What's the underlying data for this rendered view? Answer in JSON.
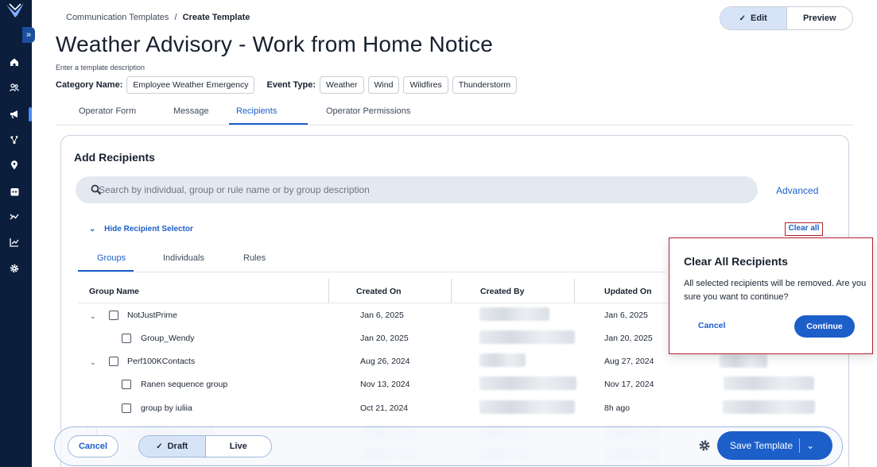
{
  "breadcrumb": {
    "parent": "Communication Templates",
    "separator": "/",
    "current": "Create Template"
  },
  "page_title": "Weather Advisory - Work from Home Notice",
  "description_placeholder": "Enter a template description",
  "category": {
    "label": "Category Name:",
    "value": "Employee Weather Emergency"
  },
  "event_type": {
    "label": "Event Type:",
    "values": [
      "Weather",
      "Wind",
      "Wildfires",
      "Thunderstorm"
    ]
  },
  "mode_toggle": {
    "edit": "Edit",
    "preview": "Preview",
    "selected": "Edit"
  },
  "tabs": [
    "Operator Form",
    "Message",
    "Recipients",
    "Operator Permissions"
  ],
  "active_tab": "Recipients",
  "recipients": {
    "title": "Add Recipients",
    "search_placeholder": "Search by individual, group or rule name or by group description",
    "advanced": "Advanced",
    "hide_selector": "Hide Recipient Selector",
    "clear_all": "Clear all",
    "subtabs": [
      "Groups",
      "Individuals",
      "Rules"
    ],
    "active_subtab": "Groups",
    "columns": [
      "Group Name",
      "Created On",
      "Created By",
      "Updated On"
    ],
    "rows": [
      {
        "name": "NotJustPrime",
        "created": "Jan 6, 2025",
        "updated": "Jan 6, 2025",
        "expandable": true
      },
      {
        "name": "Group_Wendy",
        "created": "Jan 20, 2025",
        "updated": "Jan 20, 2025",
        "expandable": false
      },
      {
        "name": "Perf100KContacts",
        "created": "Aug 26, 2024",
        "updated": "Aug 27, 2024",
        "expandable": true
      },
      {
        "name": "Ranen sequence group",
        "created": "Nov 13, 2024",
        "updated": "Nov 17, 2024",
        "expandable": false
      },
      {
        "name": "group by iuliia",
        "created": "Oct 21, 2024",
        "updated": "8h ago",
        "expandable": false
      }
    ]
  },
  "popover": {
    "title": "Clear All Recipients",
    "body": "All selected recipients will be removed. Are you sure you want to continue?",
    "cancel": "Cancel",
    "continue": "Continue"
  },
  "footer": {
    "cancel": "Cancel",
    "state_options": [
      "Draft",
      "Live"
    ],
    "selected_state": "Draft",
    "save": "Save Template"
  },
  "colors": {
    "accent": "#1d5fc9",
    "rail": "#0b1e3c",
    "alert_border": "#b4212b"
  },
  "icons": [
    "logo-icon",
    "expand-icon",
    "home-icon",
    "people-icon",
    "megaphone-icon",
    "network-icon",
    "location-icon",
    "calendar-icon",
    "flow-icon",
    "chart-icon",
    "gear-icon",
    "search-icon",
    "check-icon",
    "chevron-down-icon"
  ]
}
